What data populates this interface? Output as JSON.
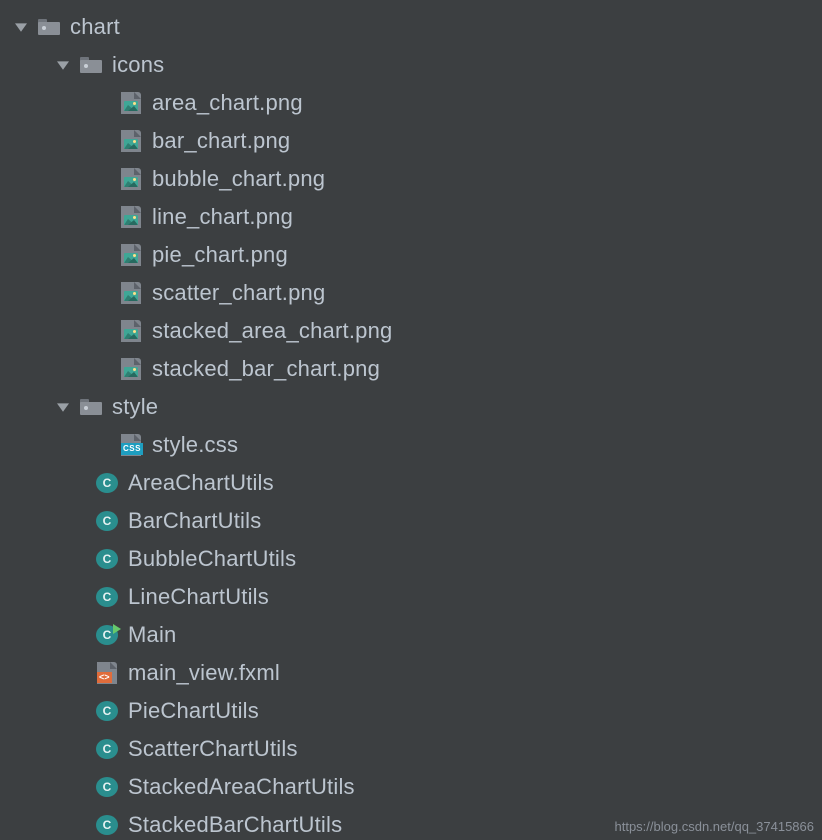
{
  "tree": {
    "root": {
      "name": "chart",
      "children": {
        "icons": {
          "name": "icons",
          "files": [
            "area_chart.png",
            "bar_chart.png",
            "bubble_chart.png",
            "line_chart.png",
            "pie_chart.png",
            "scatter_chart.png",
            "stacked_area_chart.png",
            "stacked_bar_chart.png"
          ]
        },
        "style": {
          "name": "style",
          "files": [
            "style.css"
          ]
        }
      },
      "classes": [
        "AreaChartUtils",
        "BarChartUtils",
        "BubbleChartUtils",
        "LineChartUtils",
        "Main",
        "main_view.fxml",
        "PieChartUtils",
        "ScatterChartUtils",
        "StackedAreaChartUtils",
        "StackedBarChartUtils"
      ]
    }
  },
  "icons": {
    "css_tag": "CSS",
    "fxml_tag": "<>",
    "class_letter": "C"
  },
  "watermark": "https://blog.csdn.net/qq_37415866"
}
